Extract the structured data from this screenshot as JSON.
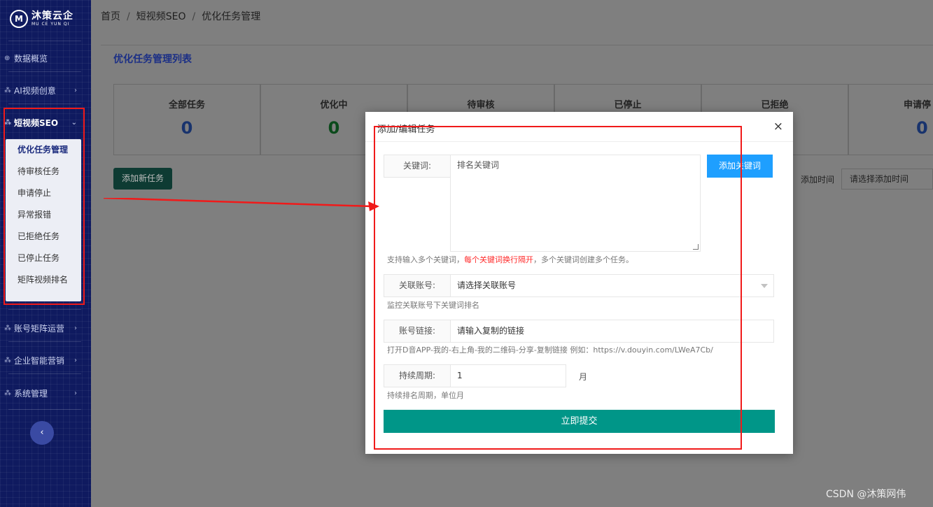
{
  "logo": {
    "mark": "M",
    "name": "沐策云企",
    "sub": "MU CE YUN QI"
  },
  "sidebar": {
    "items": [
      {
        "label": "数据概览",
        "icon": "dashboard-icon",
        "has_arrow": false
      },
      {
        "label": "AI视频创意",
        "icon": "video-icon",
        "has_arrow": true
      },
      {
        "label": "短视频SEO",
        "icon": "seo-icon",
        "has_arrow": true
      }
    ],
    "submenu": [
      "优化任务管理",
      "待审核任务",
      "申请停止",
      "异常报错",
      "已拒绝任务",
      "已停止任务",
      "矩阵视频排名"
    ],
    "items_bottom": [
      {
        "label": "账号矩阵运营",
        "icon": "matrix-icon"
      },
      {
        "label": "企业智能营销",
        "icon": "marketing-icon"
      },
      {
        "label": "系统管理",
        "icon": "settings-icon"
      }
    ],
    "collapse": "‹"
  },
  "breadcrumb": [
    "首页",
    "短视频SEO",
    "优化任务管理"
  ],
  "breadcrumb_sep": "/",
  "panel": {
    "title": "优化任务管理列表"
  },
  "stats": [
    {
      "label": "全部任务",
      "value": "0"
    },
    {
      "label": "优化中",
      "value": "0"
    },
    {
      "label": "待审核",
      "value": ""
    },
    {
      "label": "已停止",
      "value": ""
    },
    {
      "label": "已拒绝",
      "value": ""
    },
    {
      "label": "申请停",
      "value": "0"
    }
  ],
  "toolbar": {
    "add_task": "添加新任务",
    "filter_label": "添加时间",
    "filter_placeholder": "请选择添加时间"
  },
  "modal": {
    "title": "添加/编辑任务",
    "close": "×",
    "keyword": {
      "label": "关键词:",
      "placeholder": "排名关键词",
      "button": "添加关键词",
      "hint_pre": "支持输入多个关键词，",
      "hint_red": "每个关键词换行隔开",
      "hint_post": "，多个关键词创建多个任务。"
    },
    "account": {
      "label": "关联账号:",
      "placeholder": "请选择关联账号",
      "hint": "监控关联账号下关键词排名"
    },
    "link": {
      "label": "账号链接:",
      "placeholder": "请输入复制的链接",
      "hint": "打开D音APP-我的-右上角-我的二维码-分享-复制链接 例如：https://v.douyin.com/LWeA7Cb/"
    },
    "period": {
      "label": "持续周期:",
      "value": "1",
      "unit": "月",
      "hint": "持续排名周期，单位月"
    },
    "submit": "立即提交"
  },
  "annotation_color": "#f01a1a",
  "watermark": "CSDN @沐策网伟"
}
